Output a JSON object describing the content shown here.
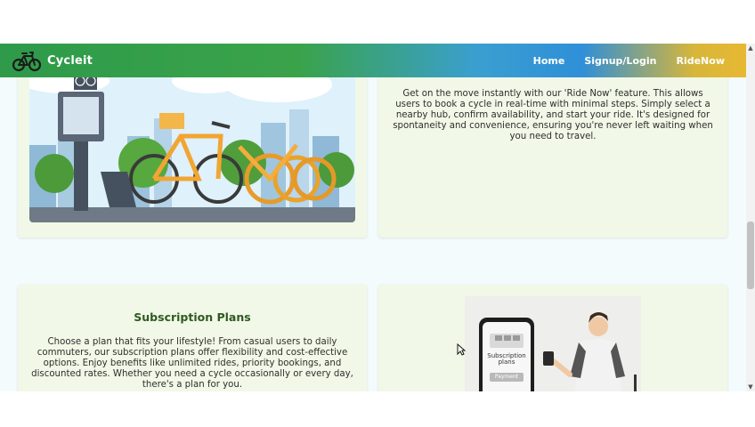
{
  "navbar": {
    "brand": "Cycleit",
    "links": [
      "Home",
      "Signup/Login",
      "RideNow"
    ],
    "gradient_colors": [
      "#2e9a4a",
      "#3a9fd0",
      "#e7b832"
    ]
  },
  "ride_now": {
    "description": "Get on the move instantly with our 'Ride Now' feature. This allows users to book a cycle in real-time with minimal steps. Simply select a nearby hub, confirm availability, and start your ride. It's designed for spontaneity and convenience, ensuring you're never left waiting when you need to travel."
  },
  "subscription": {
    "title": "Subscription Plans",
    "description": "Choose a plan that fits your lifestyle! From casual users to daily commuters, our subscription plans offer flexibility and cost-effective options. Enjoy benefits like unlimited rides, priority bookings, and discounted rates. Whether you need a cycle occasionally or every day, there's a plan for you.",
    "phone_screen_text": "Subscription plans",
    "phone_button": "Payment"
  },
  "card_background": "#f1f8e7",
  "page_background": "#f3fbfd",
  "icons": [
    "bicycle-logo-icon",
    "scroll-up-icon",
    "scroll-down-icon",
    "mouse-cursor-icon"
  ]
}
